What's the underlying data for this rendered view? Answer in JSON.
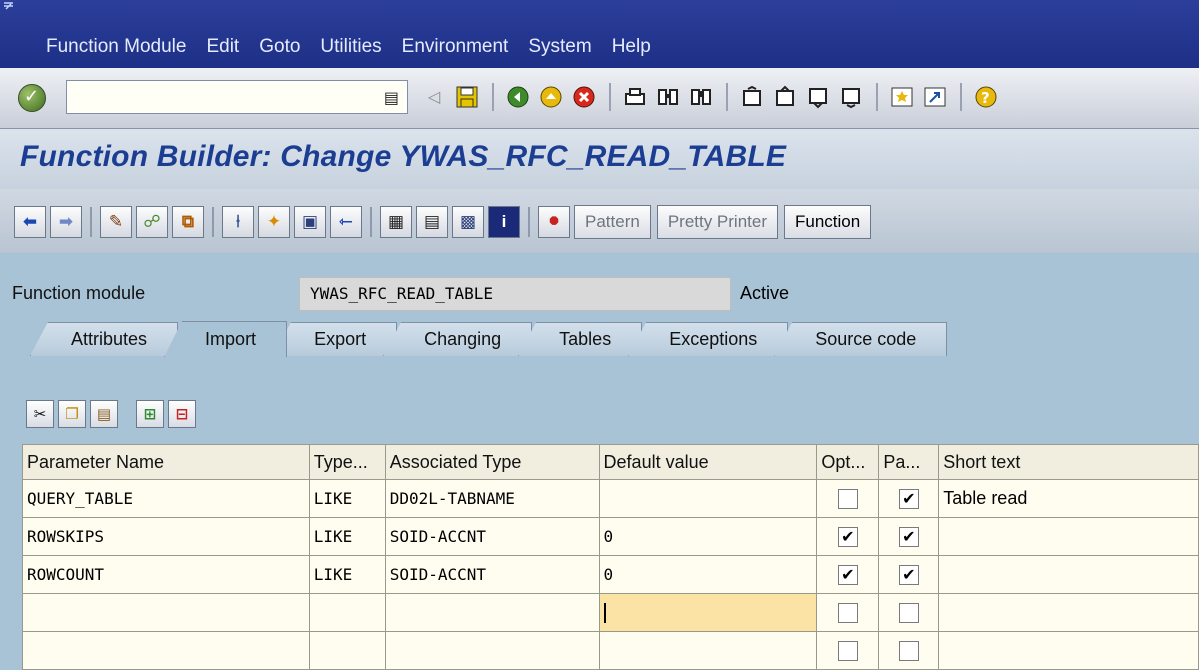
{
  "menu": {
    "items": [
      {
        "label": "Function Module"
      },
      {
        "label": "Edit"
      },
      {
        "label": "Goto"
      },
      {
        "label": "Utilities"
      },
      {
        "label": "Environment"
      },
      {
        "label": "System"
      },
      {
        "label": "Help"
      }
    ]
  },
  "std_toolbar": {
    "command_value": "",
    "icons": [
      "back-arrow-icon",
      "save-icon",
      "back-icon",
      "exit-icon",
      "cancel-icon",
      "print-icon",
      "find-icon",
      "find-next-icon",
      "first-page-icon",
      "previous-page-icon",
      "next-page-icon",
      "last-page-icon",
      "new-session-icon",
      "shortcut-icon",
      "help-icon"
    ]
  },
  "title": "Function Builder: Change YWAS_RFC_READ_TABLE",
  "app_toolbar": {
    "pattern_label": "Pattern",
    "pretty_printer_label": "Pretty Printer",
    "function_label": "Function"
  },
  "header": {
    "fm_label": "Function module",
    "fm_value": "YWAS_RFC_READ_TABLE",
    "status": "Active"
  },
  "tabs": [
    {
      "label": "Attributes"
    },
    {
      "label": "Import"
    },
    {
      "label": "Export"
    },
    {
      "label": "Changing"
    },
    {
      "label": "Tables"
    },
    {
      "label": "Exceptions"
    },
    {
      "label": "Source code"
    }
  ],
  "active_tab": "Import",
  "table": {
    "columns": [
      "Parameter Name",
      "Type...",
      "Associated Type",
      "Default value",
      "Opt...",
      "Pa...",
      "Short text"
    ],
    "rows": [
      {
        "name": "QUERY_TABLE",
        "type": "LIKE",
        "assoc": "DD02L-TABNAME",
        "default": "",
        "opt": false,
        "pass": true,
        "short": "Table read"
      },
      {
        "name": "ROWSKIPS",
        "type": "LIKE",
        "assoc": "SOID-ACCNT",
        "default": "0",
        "opt": true,
        "pass": true,
        "short": ""
      },
      {
        "name": "ROWCOUNT",
        "type": "LIKE",
        "assoc": "SOID-ACCNT",
        "default": "0",
        "opt": true,
        "pass": true,
        "short": ""
      },
      {
        "name": "",
        "type": "",
        "assoc": "",
        "default": "",
        "opt": false,
        "pass": false,
        "short": ""
      },
      {
        "name": "",
        "type": "",
        "assoc": "",
        "default": "",
        "opt": false,
        "pass": false,
        "short": ""
      }
    ]
  },
  "colors": {
    "menubar": "#1d2f86",
    "title": "#1c3e92",
    "background": "#a9c3d6",
    "focus_cell": "#fbe3a6"
  }
}
